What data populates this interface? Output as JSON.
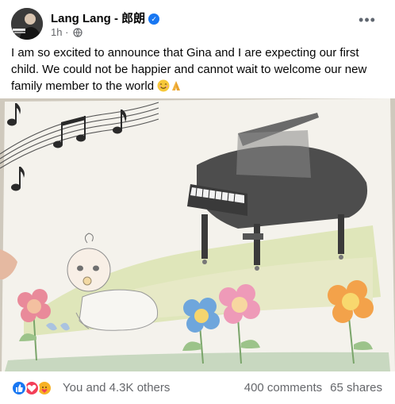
{
  "post": {
    "author": "Lang Lang - 郎朗",
    "time": "1h",
    "separator": "·",
    "more_icon": "more-horizontal-icon",
    "verified_icon": "verified-badge-icon",
    "privacy_icon": "globe-icon",
    "text": "I am so excited to announce that Gina and I are expecting our first child. We could not be happier and cannot wait to welcome our new family member to the world",
    "text_emojis": [
      "smiling-face-emoji",
      "folded-hands-emoji"
    ],
    "image_alt_subject": "drawing of a baby, grand piano, flowers and music notes"
  },
  "footer": {
    "reaction_icons": [
      "like-icon",
      "love-icon",
      "care-icon"
    ],
    "reactions_count": "You and 4.3K others",
    "comments": "400 comments",
    "shares": "65 shares"
  },
  "colors": {
    "link_blue": "#1877f2",
    "secondary_text": "#65676b",
    "love_red": "#f33e58",
    "care_yellow": "#f7b125"
  }
}
